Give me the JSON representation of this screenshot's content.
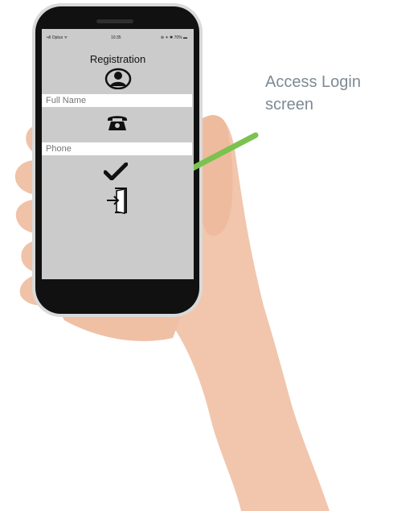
{
  "callout": {
    "line1": "Access Login",
    "line2": "screen"
  },
  "status_bar": {
    "carrier": "•ıll Optus ᯤ",
    "time": "10:35",
    "right": "⊕ ✈ ✱ 70% ▬"
  },
  "app": {
    "title": "Registration",
    "full_name_placeholder": "Full Name",
    "phone_placeholder": "Phone"
  },
  "icons": {
    "avatar": "user-avatar-icon",
    "telephone": "telephone-icon",
    "submit": "checkmark-icon",
    "login": "login-door-icon"
  },
  "colors": {
    "screen_bg": "#cbcbcb",
    "arrow": "#7cc24e",
    "callout_text": "#7d8a93"
  }
}
